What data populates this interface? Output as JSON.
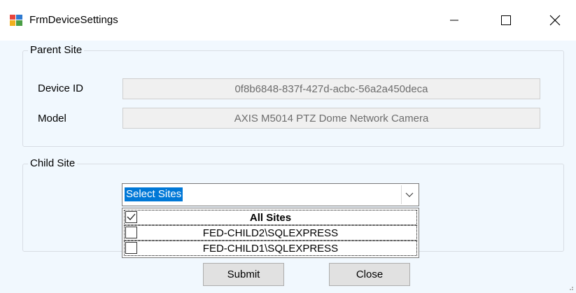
{
  "window": {
    "title": "FrmDeviceSettings",
    "icon": "windows-form-icon",
    "controls": [
      "minimize-icon",
      "maximize-icon",
      "close-icon"
    ]
  },
  "parent_site": {
    "legend": "Parent Site",
    "device_id_label": "Device ID",
    "device_id_value": "0f8b6848-837f-427d-acbc-56a2a450deca",
    "model_label": "Model",
    "model_value": "AXIS M5014 PTZ Dome Network Camera"
  },
  "child_site": {
    "legend": "Child Site",
    "combo_value": "Select Sites",
    "options": [
      {
        "label": "All Sites",
        "checked": true
      },
      {
        "label": "FED-CHILD2\\SQLEXPRESS",
        "checked": false
      },
      {
        "label": "FED-CHILD1\\SQLEXPRESS",
        "checked": false
      }
    ]
  },
  "buttons": {
    "submit": "Submit",
    "close": "Close"
  },
  "colors": {
    "client_bg": "#f1f8fe",
    "selection": "#0078d7",
    "button_bg": "#e1e1e1"
  }
}
